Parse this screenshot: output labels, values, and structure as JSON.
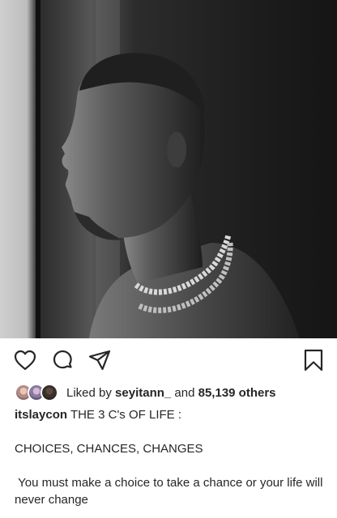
{
  "post": {
    "username": "itslaycon",
    "liked_by_prefix": "Liked by",
    "liked_by_user": "seyitann_",
    "liked_by_and": "and",
    "liked_by_count": "85,139 others",
    "caption_first": "THE 3 C's OF LIFE :",
    "caption_line2": "CHOICES, CHANCES, CHANGES",
    "caption_line3": " You must make a choice to take a chance or your life will never change"
  },
  "icons": {
    "like": "heart-icon",
    "comment": "comment-icon",
    "share": "paper-plane-icon",
    "save": "bookmark-icon"
  }
}
